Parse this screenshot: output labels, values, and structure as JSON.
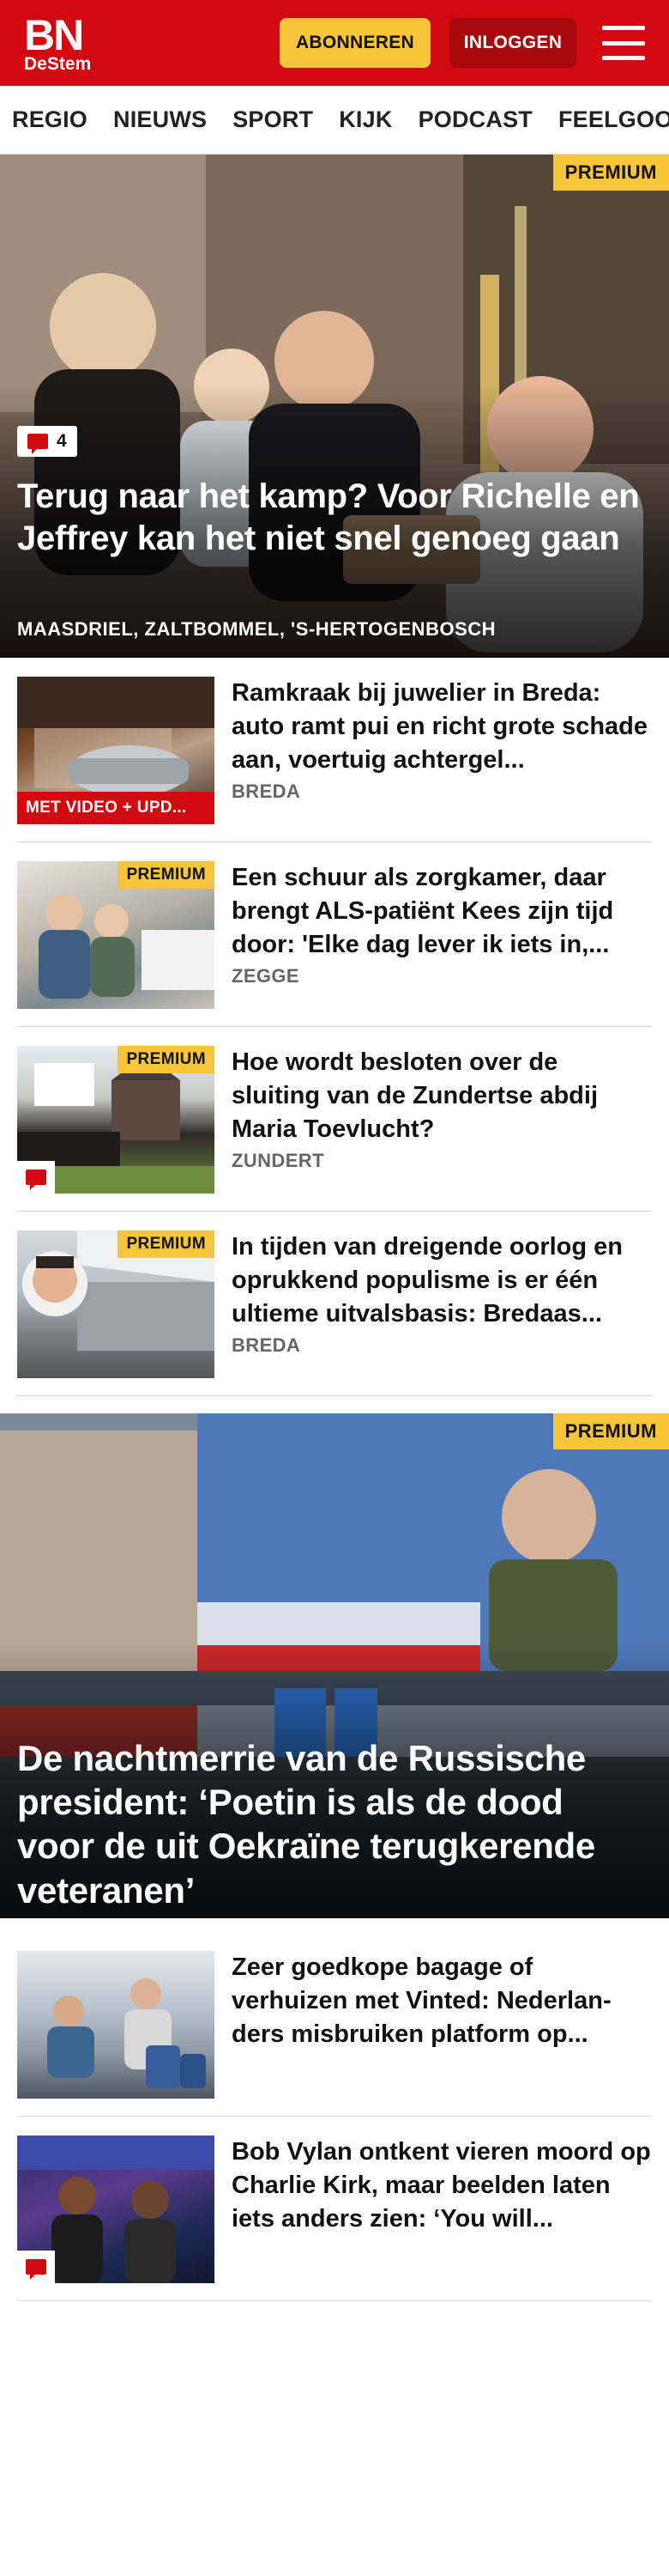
{
  "header": {
    "logo_main": "BN",
    "logo_sub": "DeStem",
    "subscribe_label": "ABONNEREN",
    "login_label": "INLOGGEN",
    "brand_color": "#d10a11",
    "accent_color": "#f7c53a"
  },
  "nav": {
    "items": [
      {
        "label": "REGIO"
      },
      {
        "label": "NIEUWS"
      },
      {
        "label": "SPORT"
      },
      {
        "label": "KIJK"
      },
      {
        "label": "PODCAST"
      },
      {
        "label": "FEELGOOD"
      }
    ]
  },
  "hero1": {
    "premium": "PREMIUM",
    "comment_count": "4",
    "title": "Terug naar het kamp? Voor Richelle en Jeffrey kan het niet snel genoeg gaan",
    "location": "MAASDRIEL, ZALTBOMMEL, 'S-HERTOGENBOSCH"
  },
  "articles1": [
    {
      "title": "Ramkraak bij juwelier in Breda: auto ramt pui en richt grote schade aan, voertuig achtergel...",
      "location": "BREDA",
      "tag": "MET VIDEO + UPD..."
    },
    {
      "title": "Een schuur als zorgkamer, daar brengt ALS-patiënt Kees zijn tijd door: 'Elke dag lever ik iets in,...",
      "location": "ZEGGE",
      "premium": "PREMIUM"
    },
    {
      "title": "Hoe wordt besloten over de sluiting van de Zundertse abdij Maria Toevlucht?",
      "location": "ZUNDERT",
      "premium": "PREMIUM"
    },
    {
      "title": "In tijden van dreigende oorlog en oprukkend populisme is er één ultieme uitvalsbasis: Bredaas...",
      "location": "BREDA",
      "premium": "PREMIUM"
    }
  ],
  "hero2": {
    "premium": "PREMIUM",
    "title": "De nachtmerrie van de Russische president: ‘Poetin is als de dood voor de uit Oekraïne terugkerende veteranen’"
  },
  "articles2": [
    {
      "title": "Zeer goedkope bagage of verhuizen met Vinted: Nederlan­ders misbruiken platform op..."
    },
    {
      "title": "Bob Vylan ontkent vieren moord op Charlie Kirk, maar beelden laten iets anders zien: ‘You will..."
    }
  ]
}
